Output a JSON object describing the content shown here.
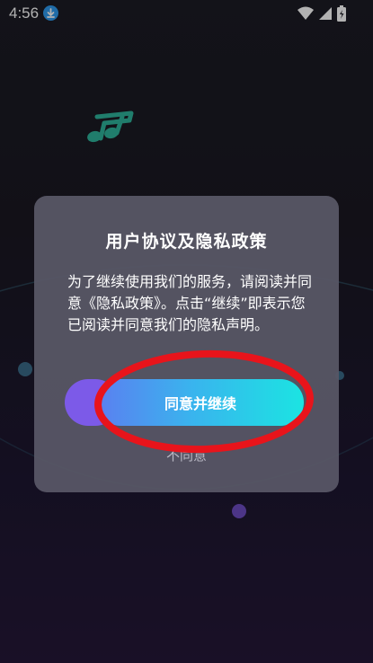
{
  "status_bar": {
    "time": "4:56"
  },
  "dialog": {
    "title": "用户协议及隐私政策",
    "body_prefix": "为了继续使用我们的服务，请阅读并同意",
    "policy_link": "《隐私政策》",
    "body_suffix": "。点击“继续”即表示您已阅读并同意我们的隐私声明。",
    "agree_label": "同意并继续",
    "decline_label": "不同意"
  },
  "icons": {
    "status_left": "download-icon",
    "status_right": [
      "wifi-icon",
      "signal-icon",
      "battery-icon"
    ],
    "background": "music-note-icon"
  },
  "colors": {
    "accent_start": "#5b7ff0",
    "accent_end": "#1be4e2",
    "annotation": "#e8141b",
    "note": "#2fb39b"
  }
}
